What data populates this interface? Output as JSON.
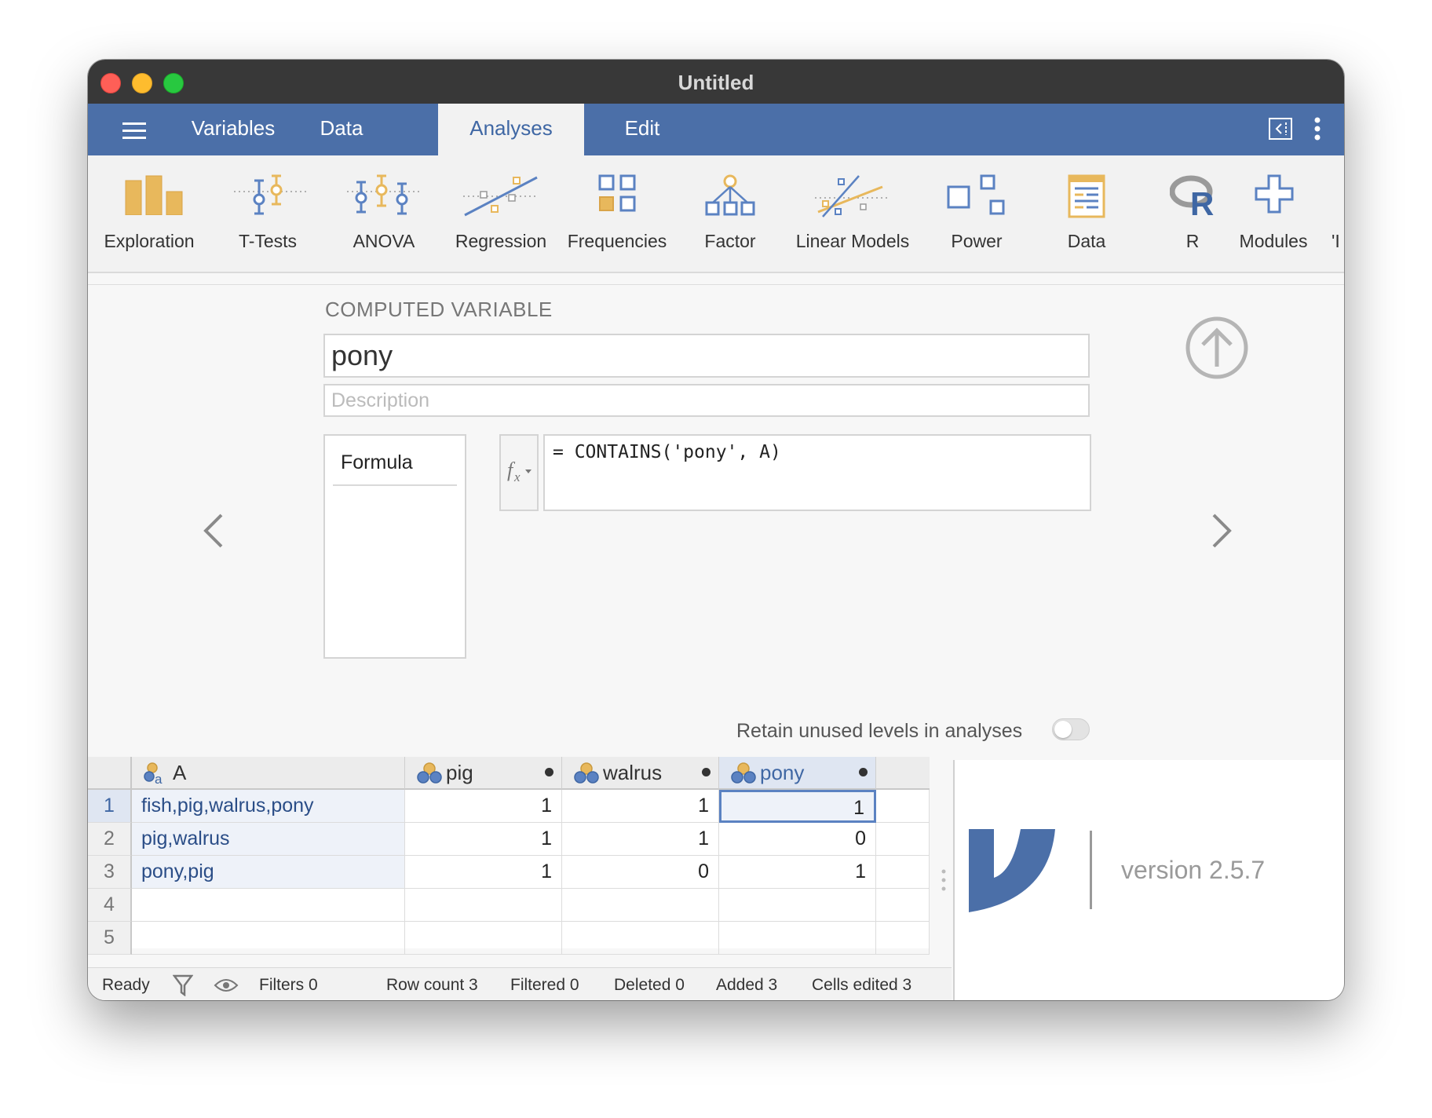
{
  "window": {
    "title": "Untitled"
  },
  "menu": {
    "tabs": [
      {
        "label": "Variables"
      },
      {
        "label": "Data"
      },
      {
        "label": "Analyses"
      },
      {
        "label": "Edit"
      }
    ],
    "active_tab": "Analyses"
  },
  "toolbar": {
    "items": [
      {
        "label": "Exploration",
        "icon": "bar-chart-icon"
      },
      {
        "label": "T-Tests",
        "icon": "t-tests-icon"
      },
      {
        "label": "ANOVA",
        "icon": "anova-icon"
      },
      {
        "label": "Regression",
        "icon": "regression-icon"
      },
      {
        "label": "Frequencies",
        "icon": "frequencies-icon"
      },
      {
        "label": "Factor",
        "icon": "factor-icon"
      },
      {
        "label": "Linear Models",
        "icon": "linear-models-icon"
      },
      {
        "label": "Power",
        "icon": "power-icon"
      },
      {
        "label": "Data",
        "icon": "data-sheet-icon"
      },
      {
        "label": "R",
        "icon": "r-icon"
      },
      {
        "label": "Modules",
        "icon": "plus-icon"
      }
    ]
  },
  "computed": {
    "heading": "COMPUTED VARIABLE",
    "name": "pony",
    "description_placeholder": "Description",
    "formula_list_item": "Formula",
    "formula": "= CONTAINS('pony', A)",
    "retain_label": "Retain unused levels in analyses",
    "retain_enabled": false
  },
  "grid": {
    "columns": [
      {
        "name": "A",
        "type": "nominal-text"
      },
      {
        "name": "pig",
        "type": "nominal"
      },
      {
        "name": "walrus",
        "type": "nominal"
      },
      {
        "name": "pony",
        "type": "nominal"
      }
    ],
    "row_numbers": [
      "1",
      "2",
      "3",
      "4",
      "5"
    ],
    "rows": [
      {
        "A": "fish,pig,walrus,pony",
        "pig": "1",
        "walrus": "1",
        "pony": "1"
      },
      {
        "A": "pig,walrus",
        "pig": "1",
        "walrus": "1",
        "pony": "0"
      },
      {
        "A": "pony,pig",
        "pig": "1",
        "walrus": "0",
        "pony": "1"
      }
    ]
  },
  "status": {
    "ready": "Ready",
    "filters": "Filters 0",
    "row_count": "Row count 3",
    "filtered": "Filtered 0",
    "deleted": "Deleted 0",
    "added": "Added 3",
    "cells_edited": "Cells edited 3"
  },
  "version": "version 2.5.7",
  "colors": {
    "menu_bar": "#4b6fa8",
    "accent": "#3f67a4",
    "icon_orange": "#e8b85c",
    "icon_blue": "#5b82c2"
  }
}
